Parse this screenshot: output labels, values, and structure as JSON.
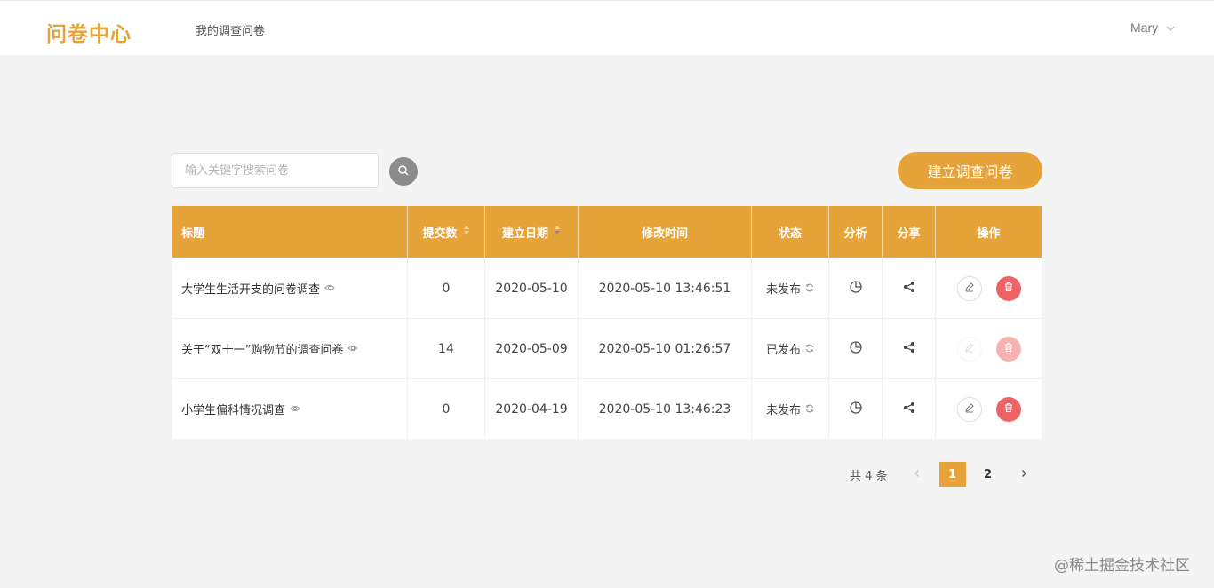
{
  "header": {
    "logo": "问卷中心",
    "nav_link": "我的调查问卷",
    "user": "Mary"
  },
  "toolbar": {
    "search_placeholder": "输入关键字搜索问卷",
    "create_label": "建立调查问卷"
  },
  "table": {
    "columns": [
      "标题",
      "提交数",
      "建立日期",
      "修改时间",
      "状态",
      "分析",
      "分享",
      "操作"
    ],
    "rows": [
      {
        "title": "大学生生活开支的问卷调查",
        "submissions": "0",
        "created": "2020-05-10",
        "modified": "2020-05-10 13:46:51",
        "status": "未发布",
        "actions_enabled": true
      },
      {
        "title": "关于“双十一”购物节的调查问卷",
        "submissions": "14",
        "created": "2020-05-09",
        "modified": "2020-05-10 01:26:57",
        "status": "已发布",
        "actions_enabled": false
      },
      {
        "title": "小学生偏科情况调查",
        "submissions": "0",
        "created": "2020-04-19",
        "modified": "2020-05-10 13:46:23",
        "status": "未发布",
        "actions_enabled": true
      }
    ]
  },
  "pagination": {
    "total_text": "共 4 条",
    "pages": [
      "1",
      "2"
    ],
    "current": "1"
  },
  "watermark": "@稀土掘金技术社区",
  "colors": {
    "accent": "#e5a33a",
    "danger": "#ee6466",
    "background": "#f4f4f4"
  },
  "icons": [
    "search-icon",
    "chevron-down-icon",
    "sort-icon",
    "eye-icon",
    "refresh-icon",
    "pie-chart-icon",
    "share-icon",
    "edit-icon",
    "delete-icon",
    "chevron-left-icon",
    "chevron-right-icon"
  ]
}
